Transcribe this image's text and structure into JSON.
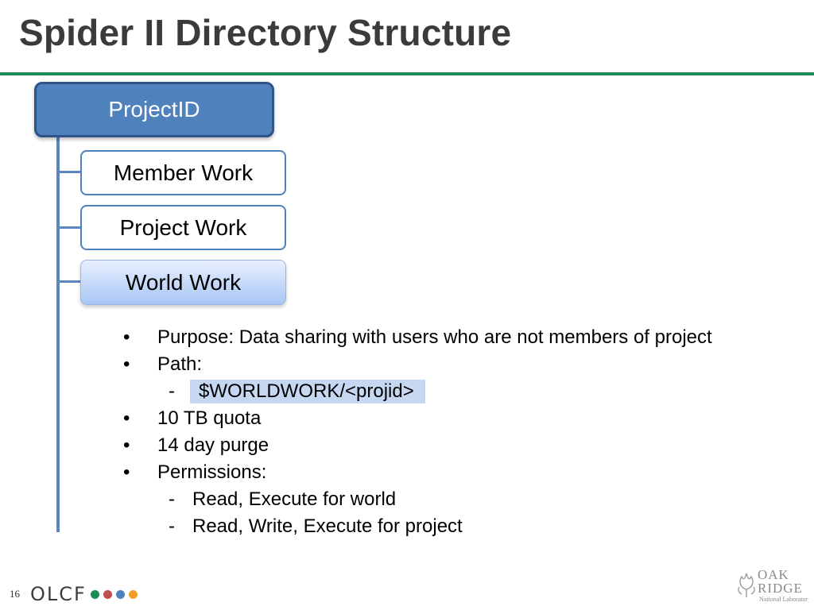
{
  "slide": {
    "title": "Spider II Directory Structure",
    "page_number": "16"
  },
  "tree": {
    "root": "ProjectID",
    "children": [
      "Member Work",
      "Project Work",
      "World Work"
    ],
    "selected": "World Work"
  },
  "bullets": {
    "items": [
      {
        "text": "Purpose: Data sharing with users who are not members of project"
      },
      {
        "text": "Path:"
      },
      {
        "sub": "$WORLDWORK/<projid>"
      },
      {
        "text": "10 TB quota"
      },
      {
        "text": "14 day purge"
      },
      {
        "text": "Permissions:"
      },
      {
        "sub": "Read, Execute for world"
      },
      {
        "sub": "Read, Write, Execute for project"
      }
    ],
    "bullet_char": "•",
    "dash_char": "-"
  },
  "footer": {
    "olcf_text": "OLCF",
    "olcf_dot_colors": [
      "#1e8a5a",
      "#c0504d",
      "#4f81bd",
      "#f39c2b"
    ],
    "ornl_logo": {
      "line1": "OAK",
      "line2": "RIDGE",
      "line3": "National Laboratory"
    }
  },
  "colors": {
    "title_rule": "#1e8a5a",
    "root_fill": "#4f81bd",
    "tree_line": "#5b86c0",
    "path_highlight": "#c6d7f2"
  }
}
